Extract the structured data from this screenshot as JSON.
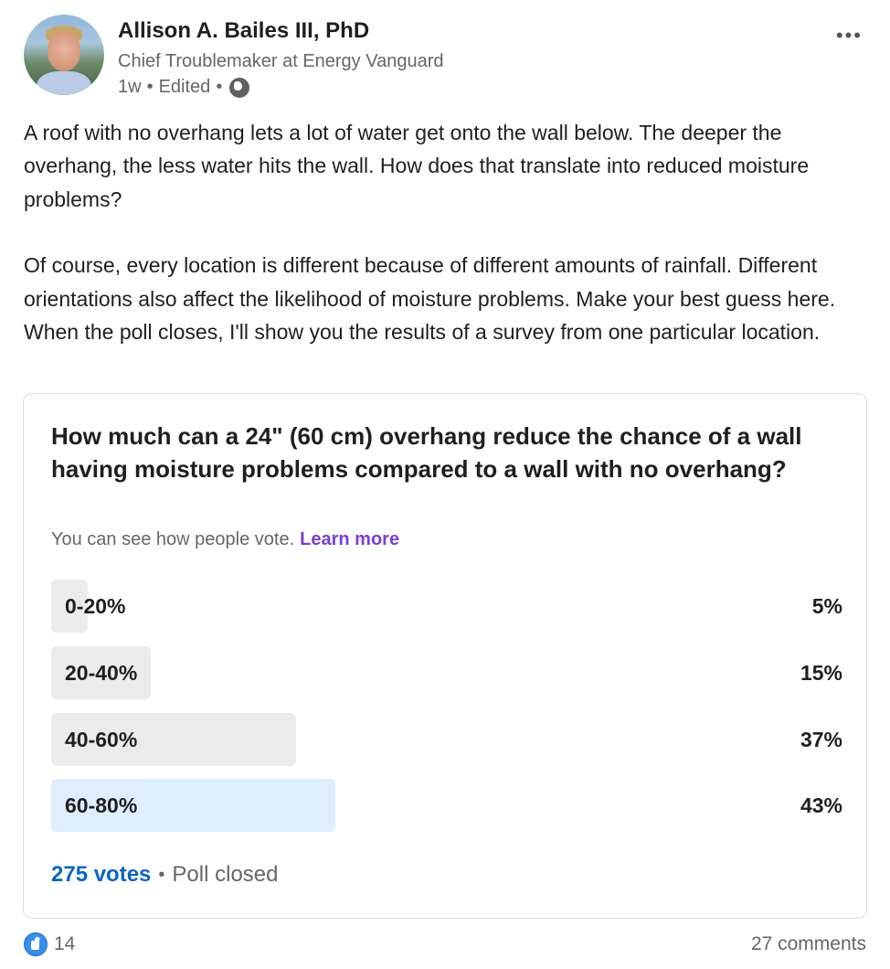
{
  "author": {
    "name": "Allison A. Bailes III, PhD",
    "headline": "Chief Troublemaker at Energy Vanguard",
    "time": "1w",
    "edited": "Edited",
    "sep": "•",
    "more_glyph": "•••"
  },
  "post": {
    "paragraph1": "A roof with no overhang lets a lot of water get onto the wall below. The deeper the overhang, the less water hits the wall. How does that translate into reduced moisture problems?",
    "paragraph2": "Of course, every location is different because of different amounts of rainfall. Different orientations also affect the likelihood of moisture problems. Make your best guess here. When the poll closes, I'll show you the results of a survey from one particular location."
  },
  "poll": {
    "question": "How much can a 24\" (60 cm) overhang reduce the chance of a wall having moisture problems compared to a wall with no overhang?",
    "visibility_text": "You can see how people vote.",
    "learn_more": "Learn more",
    "options": [
      {
        "label": "0-20%",
        "percent_text": "5%",
        "fill_fraction": 0.05,
        "selected": false
      },
      {
        "label": "20-40%",
        "percent_text": "15%",
        "fill_fraction": 0.15,
        "selected": false
      },
      {
        "label": "40-60%",
        "percent_text": "37%",
        "fill_fraction": 0.37,
        "selected": false
      },
      {
        "label": "60-80%",
        "percent_text": "43%",
        "fill_fraction": 0.43,
        "selected": true
      }
    ],
    "votes": "275 votes",
    "sep": "•",
    "status": "Poll closed"
  },
  "social": {
    "reactions_count": "14",
    "comments": "27 comments"
  },
  "colors": {
    "link_blue": "#0a66c2",
    "learn_more_purple": "#7a3fd0",
    "bar_gray": "#ebebeb",
    "bar_selected": "#dfeefd"
  }
}
